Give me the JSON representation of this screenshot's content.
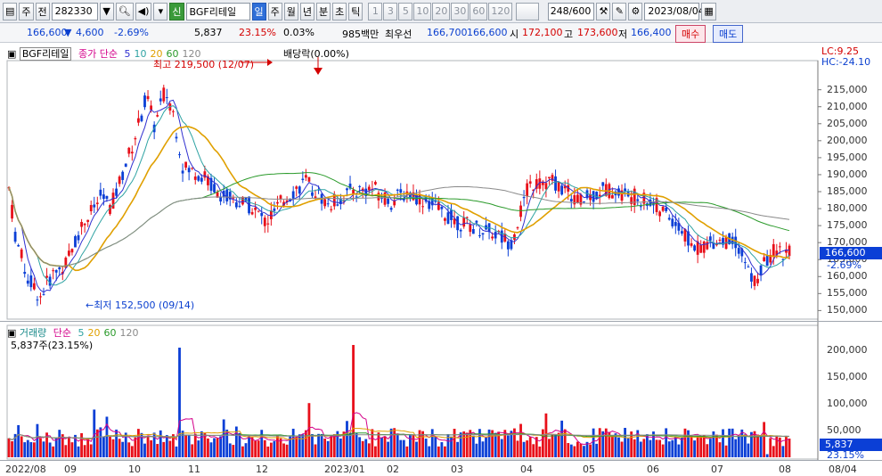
{
  "toolbar": {
    "market": "주",
    "scope": "전",
    "code": "282330",
    "stock_badge": "신",
    "stock_name": "BGF리테일",
    "periods": [
      "일",
      "주",
      "월",
      "년",
      "분",
      "초",
      "틱"
    ],
    "period_selected": "일",
    "minutes": [
      "1",
      "3",
      "5",
      "10",
      "20",
      "30",
      "60",
      "120"
    ],
    "count": "248/600",
    "date": "2023/08/04"
  },
  "infobar": {
    "price": "166,600",
    "change": "4,600",
    "change_pct": "-2.69%",
    "volume": "5,837",
    "vol_ratio": "23.15%",
    "turnover": "0.03%",
    "amount": "985백만",
    "bid_label": "최우선",
    "bid1": "166,700",
    "bid2": "166,600",
    "open_label": "시",
    "open": "172,100",
    "high_label": "고",
    "high": "173,600",
    "low_label": "저",
    "low": "166,400",
    "buy": "매수",
    "sell": "매도"
  },
  "main": {
    "legend_name": "BGF리테일",
    "legend_ma": "종가 단순",
    "ma_periods": [
      "5",
      "10",
      "20",
      "60",
      "120"
    ],
    "ma_colors": [
      "#3030d0",
      "#2fa3a3",
      "#e0a000",
      "#2a9a2a",
      "#8a8a8a"
    ],
    "high_note": "최고 219,500 (12/07)",
    "low_note": "←최저 152,500 (09/14)",
    "div_note": "배당락(0.00%)",
    "lc": "LC:9.25",
    "hc": "HC:-24.10",
    "price_tag": "166,600",
    "pct_tag": "-2.69%",
    "yticks": [
      "215,000",
      "210,000",
      "205,000",
      "200,000",
      "195,000",
      "190,000",
      "185,000",
      "180,000",
      "175,000",
      "170,000",
      "165,000",
      "160,000",
      "155,000",
      "150,000"
    ]
  },
  "volume": {
    "legend_name": "거래량",
    "legend_ma": "단순",
    "ma_periods": [
      "5",
      "20",
      "60",
      "120"
    ],
    "value_line": "5,837주(23.15%)",
    "tag": "5,837",
    "tag_pct": "23.15%",
    "yticks": [
      "200,000",
      "150,000",
      "100,000",
      "50,000"
    ]
  },
  "xaxis": [
    "2022/08",
    "09",
    "10",
    "11",
    "12",
    "2023/01",
    "02",
    "03",
    "04",
    "05",
    "06",
    "07",
    "08",
    "08/04"
  ],
  "colors": {
    "up": "#e8101a",
    "down": "#0b3fd6",
    "accent": "#2f6fd8"
  },
  "chart_data": {
    "type": "candlestick",
    "ylim": [
      148000,
      222000
    ],
    "anchors": [
      [
        0,
        186000
      ],
      [
        5,
        172000
      ],
      [
        14,
        160000
      ],
      [
        24,
        154000
      ],
      [
        32,
        160000
      ],
      [
        44,
        164000
      ],
      [
        56,
        175000
      ],
      [
        72,
        184000
      ],
      [
        78,
        180000
      ],
      [
        96,
        200000
      ],
      [
        106,
        213000
      ],
      [
        112,
        204000
      ],
      [
        120,
        215000
      ],
      [
        126,
        209000
      ],
      [
        134,
        192000
      ],
      [
        148,
        190000
      ],
      [
        164,
        184000
      ],
      [
        185,
        181000
      ],
      [
        198,
        176000
      ],
      [
        212,
        183000
      ],
      [
        228,
        188000
      ],
      [
        246,
        181000
      ],
      [
        262,
        185000
      ],
      [
        280,
        186000
      ],
      [
        294,
        182000
      ],
      [
        306,
        185000
      ],
      [
        322,
        182000
      ],
      [
        345,
        176000
      ],
      [
        372,
        173000
      ],
      [
        386,
        170000
      ],
      [
        400,
        187000
      ],
      [
        418,
        188000
      ],
      [
        440,
        182000
      ],
      [
        458,
        186000
      ],
      [
        476,
        184000
      ],
      [
        494,
        182000
      ],
      [
        512,
        176000
      ],
      [
        528,
        168000
      ],
      [
        544,
        171000
      ],
      [
        560,
        170000
      ],
      [
        572,
        158000
      ],
      [
        588,
        168000
      ],
      [
        600,
        166600
      ]
    ],
    "vol_ylim": [
      0,
      230000
    ]
  }
}
